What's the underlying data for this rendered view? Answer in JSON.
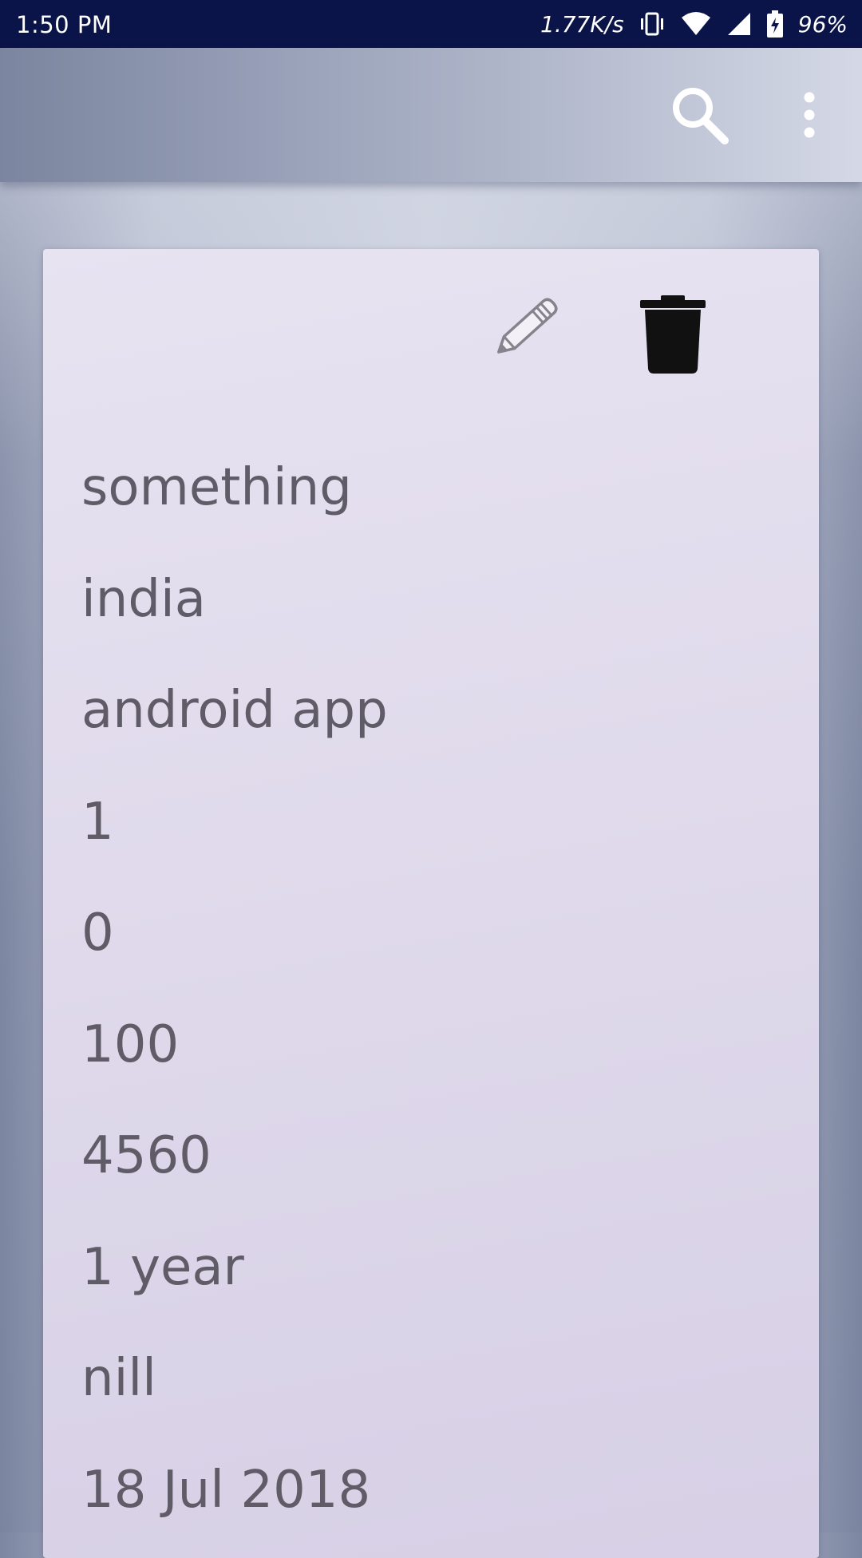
{
  "status_bar": {
    "time": "1:50 PM",
    "network_speed": "1.77K/s",
    "battery_percent": "96%",
    "icons": [
      "vibrate-icon",
      "wifi-icon",
      "cellular-signal-icon",
      "battery-charging-icon"
    ]
  },
  "app_bar": {
    "actions": [
      {
        "name": "search",
        "icon": "search-icon"
      },
      {
        "name": "more",
        "icon": "more-vert-icon"
      }
    ]
  },
  "card": {
    "actions": [
      {
        "name": "edit",
        "icon": "pencil-icon"
      },
      {
        "name": "delete",
        "icon": "trash-icon"
      }
    ],
    "fields": [
      "something",
      "india",
      "android app",
      "1",
      "0",
      "100",
      "4560",
      "1 year",
      "nill",
      "18 Jul 2018"
    ]
  },
  "colors": {
    "status_bar": "#0b1449",
    "text": "#5f5c68",
    "card": "#e2ddee"
  }
}
